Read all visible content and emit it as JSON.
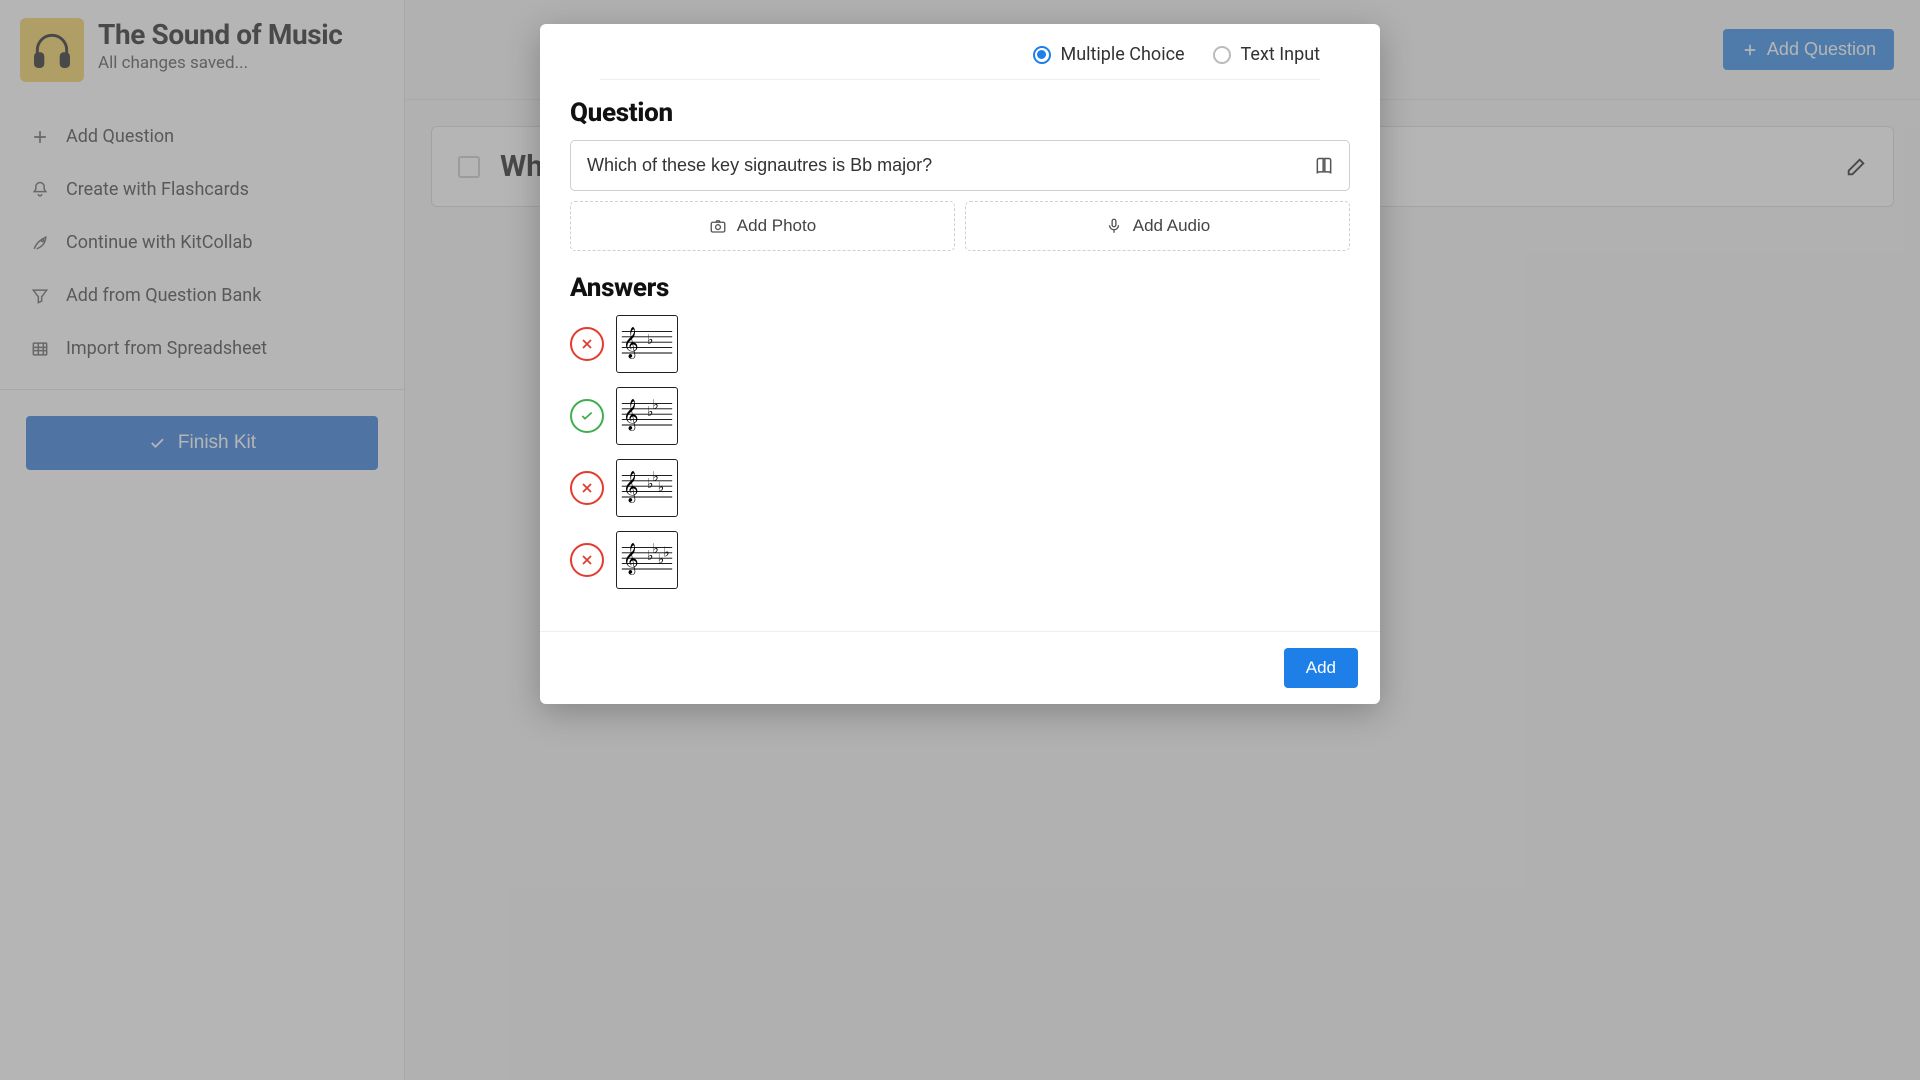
{
  "kit": {
    "title": "The Sound of Music",
    "subtitle": "All changes saved..."
  },
  "sidebar": {
    "items": [
      {
        "label": "Add Question"
      },
      {
        "label": "Create with Flashcards"
      },
      {
        "label": "Continue with KitCollab"
      },
      {
        "label": "Add from Question Bank"
      },
      {
        "label": "Import from Spreadsheet"
      }
    ],
    "finish_label": "Finish Kit"
  },
  "topbar": {
    "add_question_label": "Add Question"
  },
  "question_card": {
    "preview_text": "Wh"
  },
  "modal": {
    "type_options": {
      "multiple_choice": "Multiple Choice",
      "text_input": "Text Input",
      "selected": "multiple_choice"
    },
    "question_heading": "Question",
    "question_text": "Which of these key signautres is Bb major?",
    "add_photo_label": "Add Photo",
    "add_audio_label": "Add Audio",
    "answers_heading": "Answers",
    "answers": [
      {
        "correct": false,
        "flats": 1
      },
      {
        "correct": true,
        "flats": 2
      },
      {
        "correct": false,
        "flats": 3
      },
      {
        "correct": false,
        "flats": 4
      }
    ],
    "submit_label": "Add"
  }
}
